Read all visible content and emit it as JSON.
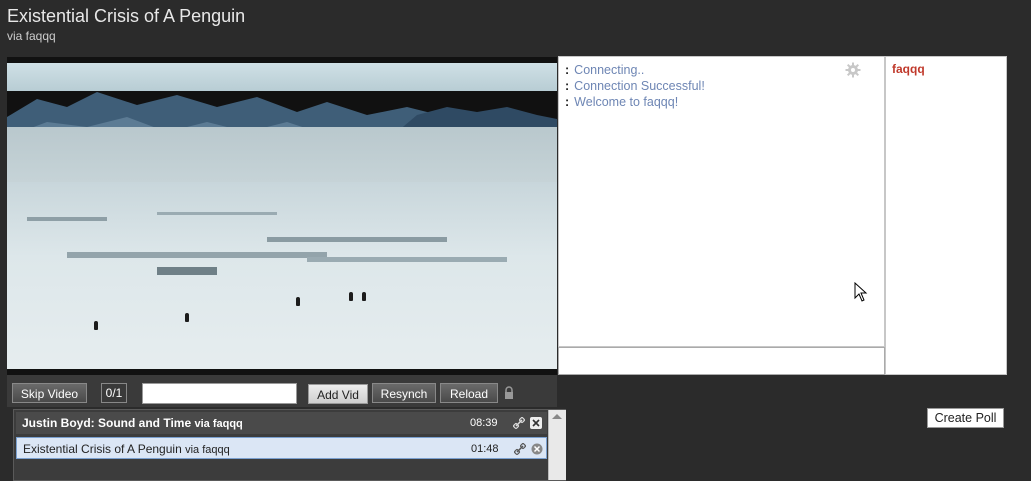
{
  "header": {
    "title": "Existential Crisis of A Penguin",
    "subtitle": "via faqqq"
  },
  "controls": {
    "skip_label": "Skip Video",
    "counter": "0/1",
    "url_value": "",
    "add_label": "Add Vid",
    "resync_label": "Resynch",
    "reload_label": "Reload"
  },
  "playlist": {
    "items": [
      {
        "title": "Justin Boyd: Sound and Time",
        "via": "via faqqq",
        "duration": "08:39"
      },
      {
        "title": "Existential Crisis of A Penguin",
        "via": "via faqqq",
        "duration": "01:48"
      }
    ]
  },
  "chat": {
    "messages": [
      {
        "prefix": ":",
        "text": "Connecting.."
      },
      {
        "prefix": ":",
        "text": "Connection Successful!"
      },
      {
        "prefix": ":",
        "text": "Welcome to faqqq!"
      }
    ],
    "input_value": ""
  },
  "users": {
    "list": [
      "faqqq"
    ]
  },
  "poll": {
    "create_label": "Create Poll"
  },
  "colors": {
    "background": "#2b2b2b",
    "chat_text": "#6e86b4",
    "username": "#c0392b",
    "selected_row": "#dbe6f5"
  }
}
